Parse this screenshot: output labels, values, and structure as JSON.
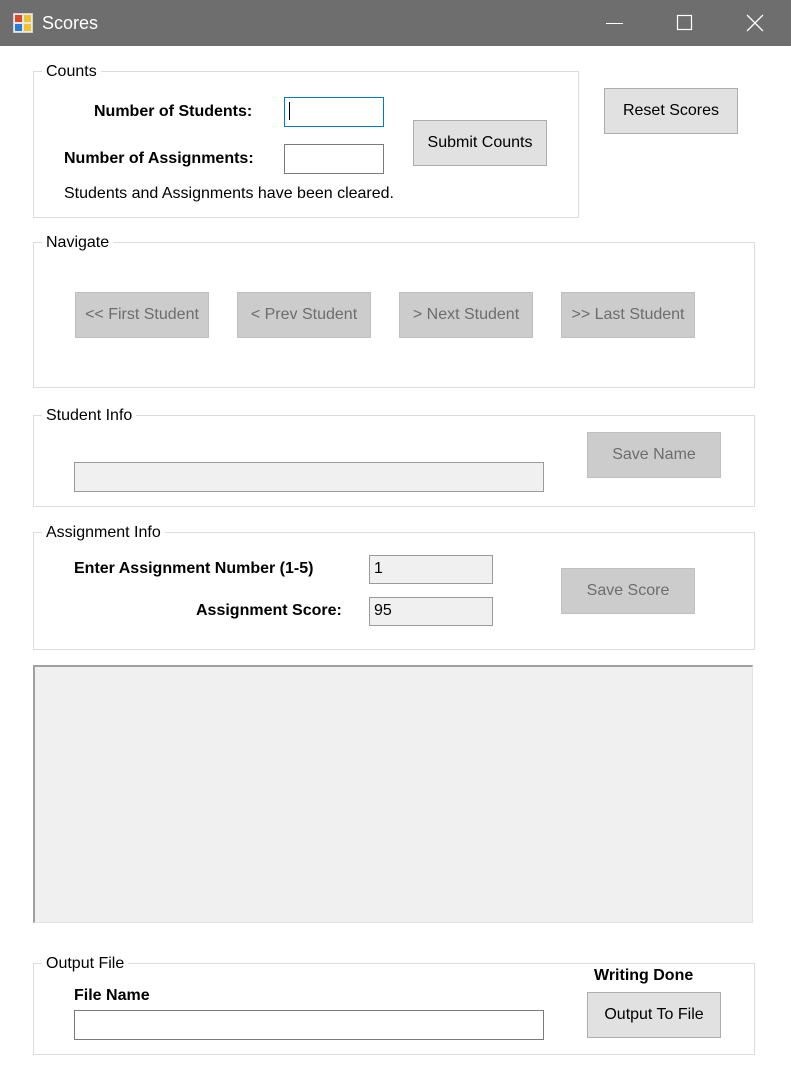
{
  "window": {
    "title": "Scores",
    "icons": {
      "app": "app-icon",
      "minimize": "minimize-icon",
      "maximize": "maximize-icon",
      "close": "close-icon"
    }
  },
  "counts": {
    "legend": "Counts",
    "students_label": "Number of Students:",
    "students_value": "",
    "assignments_label": "Number of Assignments:",
    "assignments_value": "",
    "submit_label": "Submit Counts",
    "status": "Students and Assignments have been cleared."
  },
  "reset_label": "Reset Scores",
  "navigate": {
    "legend": "Navigate",
    "first_label": "<< First Student",
    "prev_label": "< Prev Student",
    "next_label": "> Next Student",
    "last_label": ">> Last Student"
  },
  "student_info": {
    "legend": "Student Info",
    "name_value": "",
    "save_label": "Save Name"
  },
  "assignment_info": {
    "legend": "Assignment Info",
    "number_label": "Enter Assignment Number (1-5)",
    "number_value": "1",
    "score_label": "Assignment Score:",
    "score_value": "95",
    "save_label": "Save Score"
  },
  "output_file": {
    "legend": "Output File",
    "file_name_label": "File Name",
    "file_name_value": "",
    "status": "Writing Done",
    "output_label": "Output To File"
  }
}
